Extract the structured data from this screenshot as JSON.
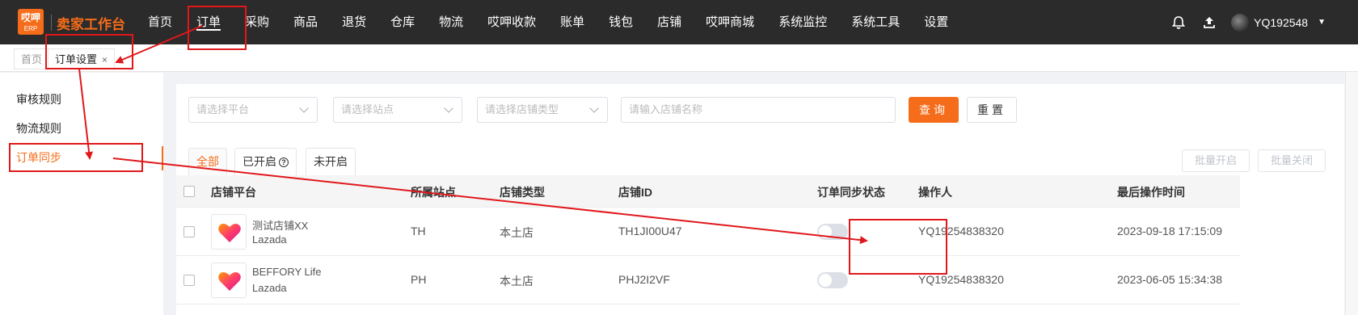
{
  "app": {
    "logo_top": "哎呷",
    "logo_bottom": "ERP",
    "title": "卖家工作台"
  },
  "nav": [
    {
      "label": "首页"
    },
    {
      "label": "订单",
      "active": true
    },
    {
      "label": "采购"
    },
    {
      "label": "商品"
    },
    {
      "label": "退货"
    },
    {
      "label": "仓库"
    },
    {
      "label": "物流"
    },
    {
      "label": "哎呷收款"
    },
    {
      "label": "账单"
    },
    {
      "label": "钱包"
    },
    {
      "label": "店铺"
    },
    {
      "label": "哎呷商城"
    },
    {
      "label": "系统监控"
    },
    {
      "label": "系统工具"
    },
    {
      "label": "设置"
    }
  ],
  "header_icons": [
    "notification-icon",
    "upload-icon"
  ],
  "user": {
    "name": "YQ192548"
  },
  "page_tabs": [
    {
      "label": "首页"
    },
    {
      "label": "订单设置",
      "close": "×"
    }
  ],
  "sidebar": {
    "items": [
      {
        "label": "审核规则"
      },
      {
        "label": "物流规则"
      },
      {
        "label": "订单同步",
        "active": true
      }
    ]
  },
  "filters": {
    "platform_placeholder": "请选择平台",
    "site_placeholder": "请选择站点",
    "store_type_placeholder": "请选择店铺类型",
    "store_name_placeholder": "请输入店铺名称",
    "query_label": "查询",
    "reset_label": "重置"
  },
  "status_tabs": [
    {
      "label": "全部",
      "active": true
    },
    {
      "label": "已开启",
      "help_icon": "question-circle-icon"
    },
    {
      "label": "未开启"
    }
  ],
  "batch": {
    "enable_label": "批量开启",
    "disable_label": "批量关闭"
  },
  "table": {
    "columns": [
      "店铺平台",
      "所属站点",
      "店铺类型",
      "店铺ID",
      "订单同步状态",
      "操作人",
      "最后操作时间"
    ],
    "rows": [
      {
        "store_name": "测试店铺XX",
        "platform": "Lazada",
        "site": "TH",
        "store_type": "本土店",
        "store_id": "TH1JI00U47",
        "sync_on": false,
        "operator": "YQ19254838320",
        "last_time": "2023-09-18 17:15:09"
      },
      {
        "store_name": "BEFFORY Life",
        "platform": "Lazada",
        "site": "PH",
        "store_type": "本土店",
        "store_id": "PHJ2I2VF",
        "sync_on": false,
        "operator": "YQ19254838320",
        "last_time": "2023-06-05 15:34:38"
      }
    ]
  },
  "colors": {
    "accent": "#f56c1a",
    "annotation_red": "#e0181b",
    "topbar": "#2b2b2b"
  }
}
